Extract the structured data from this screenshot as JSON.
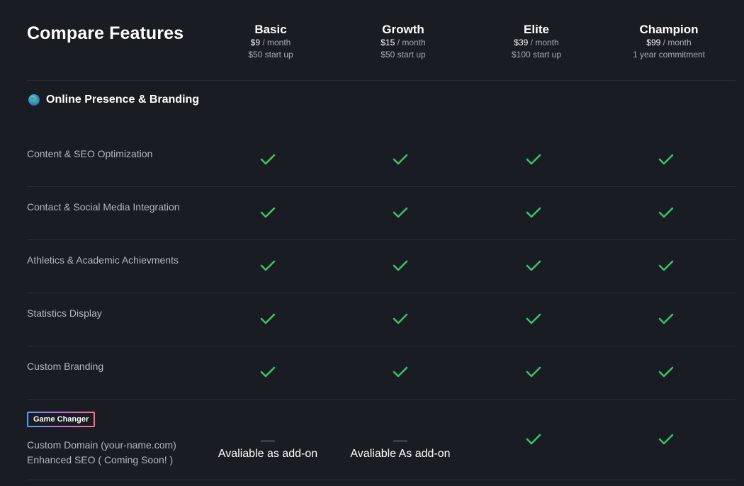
{
  "title": "Compare Features",
  "plans": [
    {
      "name": "Basic",
      "price": "$9",
      "period": " / month",
      "note": "$50 start up"
    },
    {
      "name": "Growth",
      "price": "$15",
      "period": " / month",
      "note": "$50 start up"
    },
    {
      "name": "Elite",
      "price": "$39",
      "period": " / month",
      "note": "$100 start up"
    },
    {
      "name": "Champion",
      "price": "$99",
      "period": " / month",
      "note": "1 year commitment"
    }
  ],
  "section": {
    "icon": "globe-icon",
    "label": "Online Presence & Branding"
  },
  "features": [
    {
      "label": "Content & SEO Optimization",
      "values": [
        "check",
        "check",
        "check",
        "check"
      ]
    },
    {
      "label": "Contact & Social Media Integration",
      "values": [
        "check",
        "check",
        "check",
        "check"
      ]
    },
    {
      "label": "Athletics & Academic Achievments",
      "values": [
        "check",
        "check",
        "check",
        "check"
      ]
    },
    {
      "label": "Statistics Display",
      "values": [
        "check",
        "check",
        "check",
        "check"
      ]
    },
    {
      "label": "Custom Branding",
      "values": [
        "check",
        "check",
        "check",
        "check"
      ]
    }
  ],
  "game_changer": {
    "badge": "Game Changer",
    "line1": "Custom Domain (your-name.com)",
    "line2": "Enhanced SEO ( Coming Soon! )",
    "values": [
      "dash",
      "dash",
      "check",
      "check"
    ],
    "basic_addon": "Avaliable as add-on",
    "growth_addon": "Avaliable As add-on"
  },
  "colors": {
    "background": "#191c22",
    "check": "#3fbf6a",
    "divider": "#2a2d35"
  }
}
